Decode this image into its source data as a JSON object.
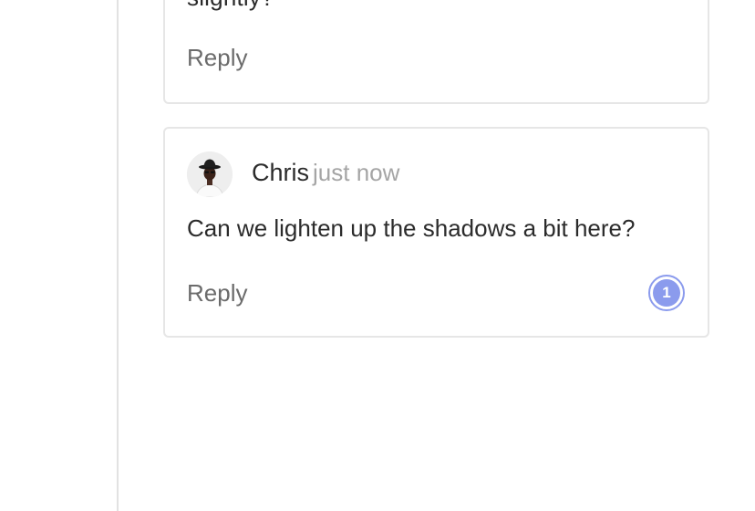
{
  "thread": {
    "previous_comment": {
      "text_tail": "slightly?",
      "reply_label": "Reply"
    },
    "comment": {
      "author": "Chris",
      "timestamp": "just now",
      "body": "Can we lighten up the shadows a bit here?",
      "reply_label": "Reply",
      "badge_count": "1",
      "avatar_icon": "user-avatar-icon"
    }
  },
  "colors": {
    "badge_accent": "#8b9bed",
    "muted_text": "#a5a5a5",
    "reply_text": "#6b6b6b",
    "border": "#e6e6e6"
  }
}
